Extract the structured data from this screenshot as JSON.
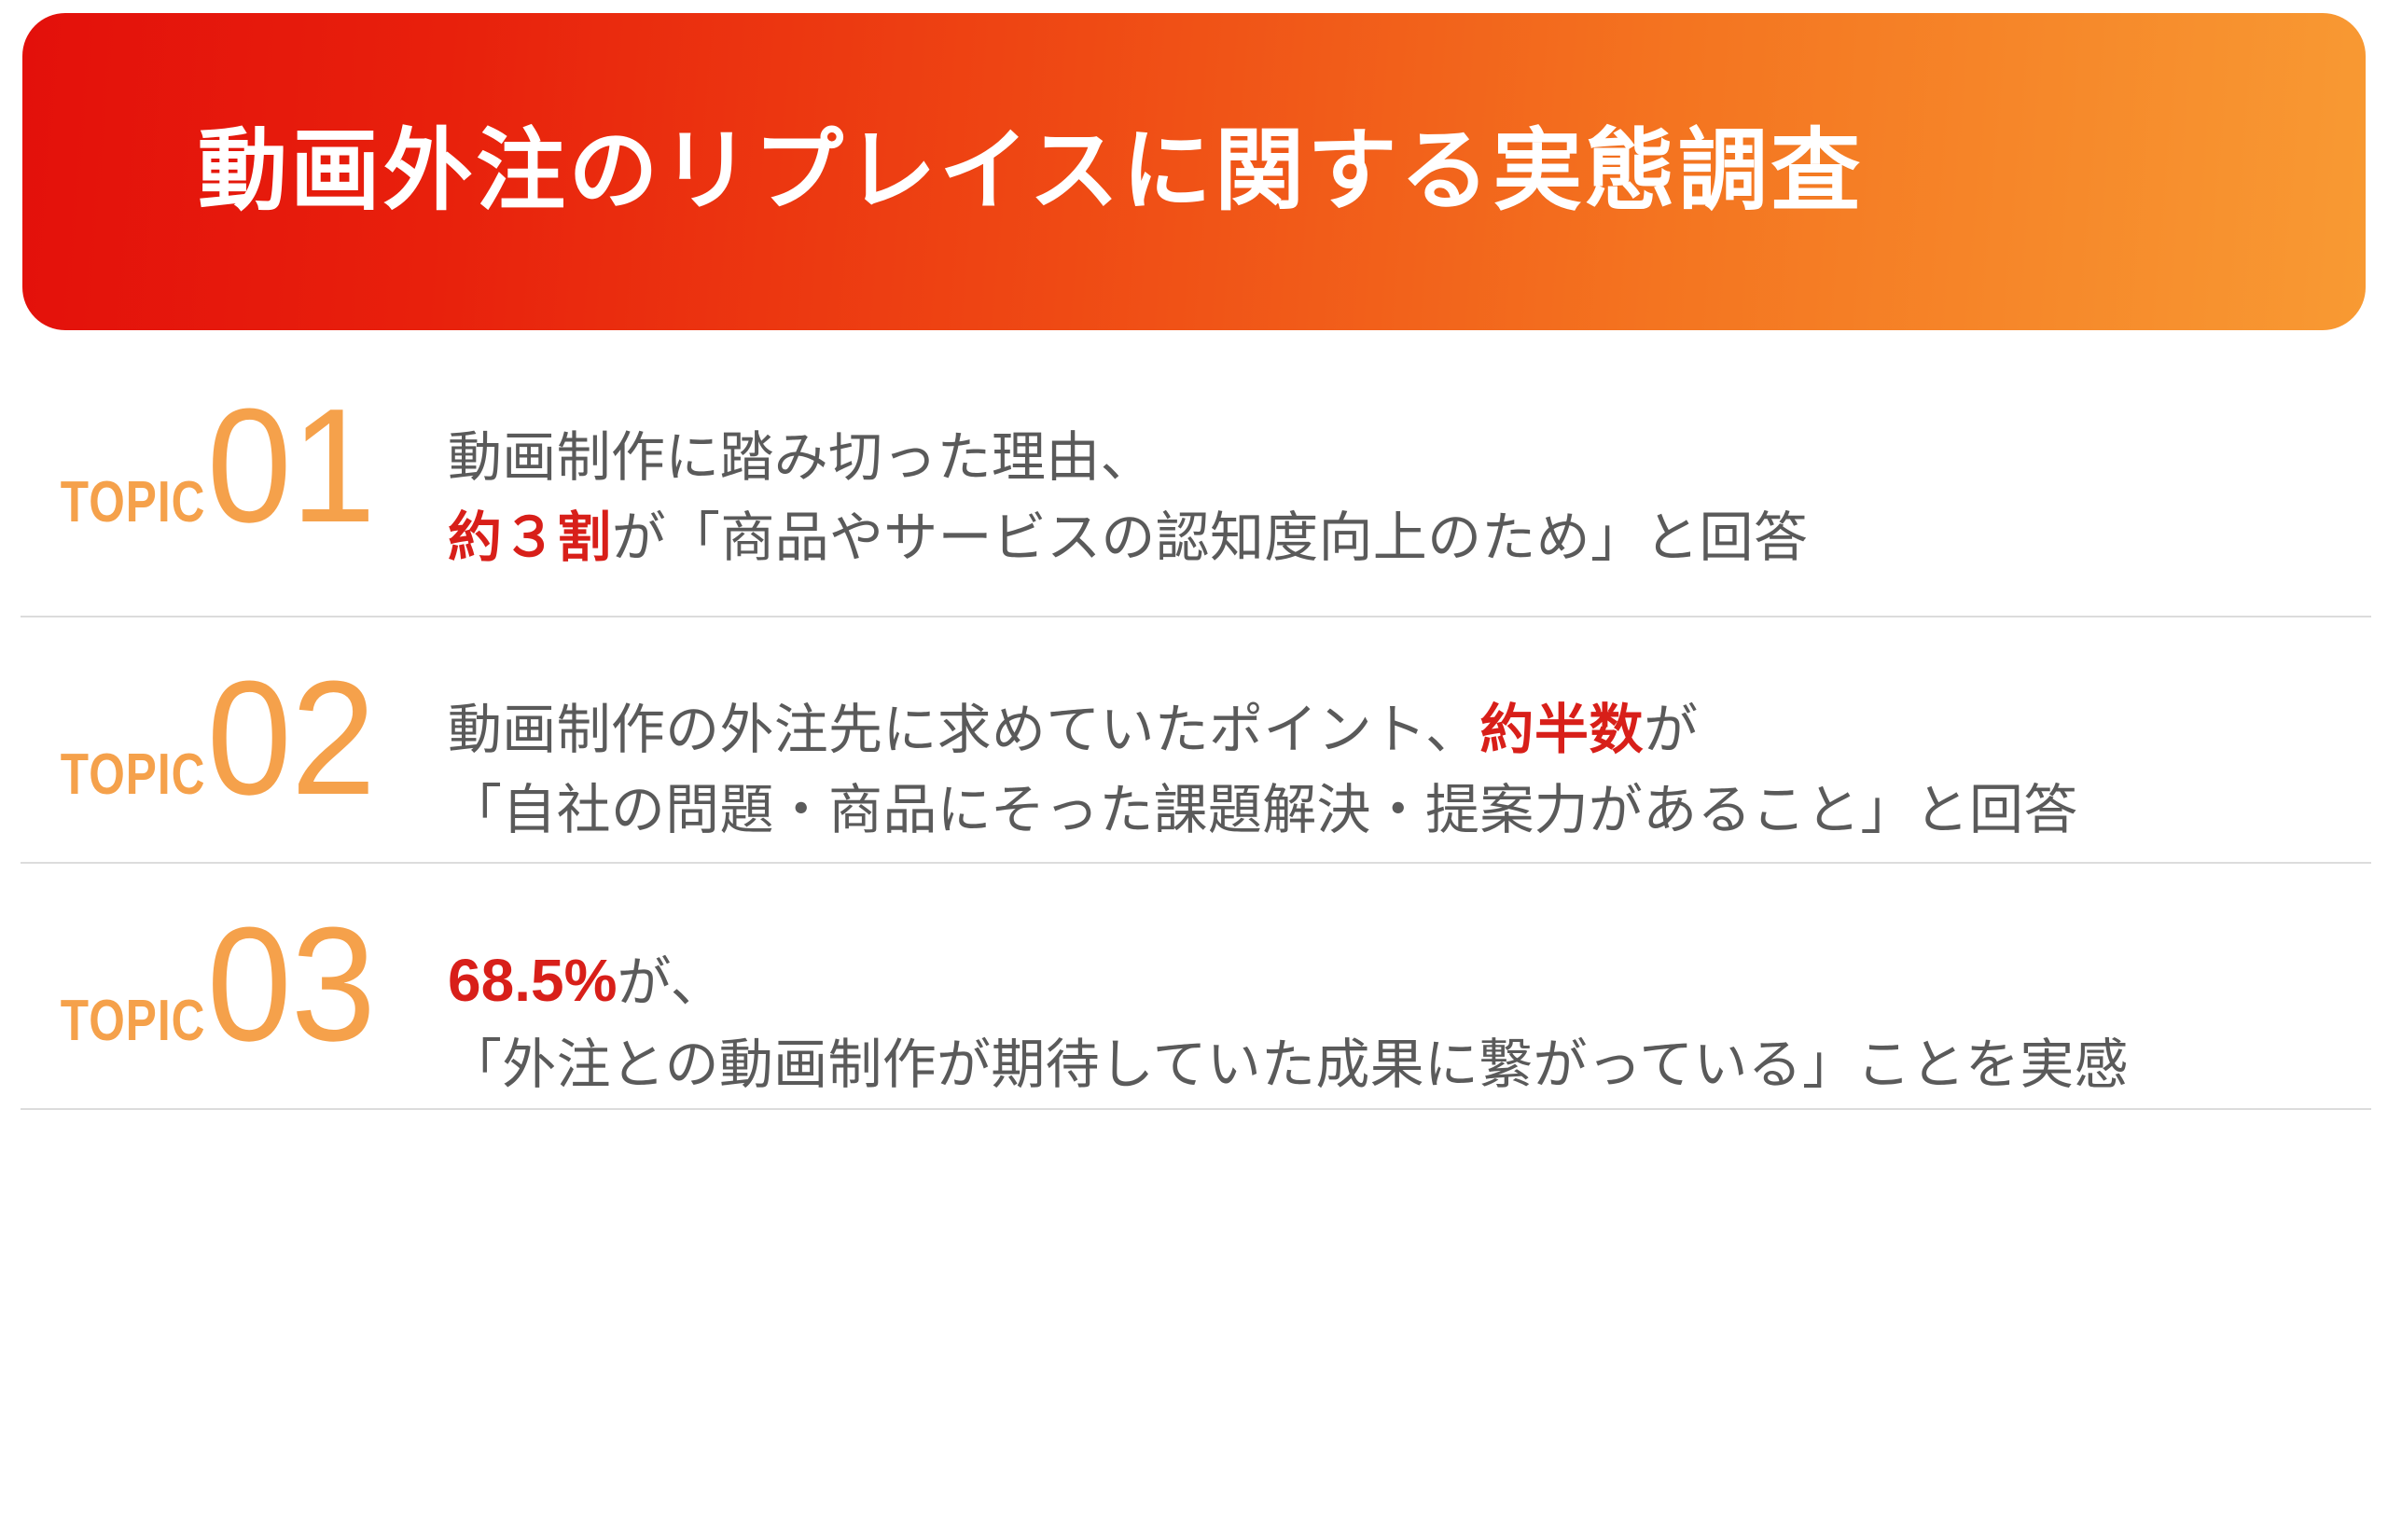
{
  "banner": {
    "title": "動画外注のリプレイスに関する実態調査",
    "gradient_start": "#e3100b",
    "gradient_end": "#f89a33",
    "text_color": "#ffffff"
  },
  "colors": {
    "topic_orange": "#f5a14b",
    "emphasis_red": "#d81f19",
    "body_gray": "#5a5a5a",
    "divider_gray": "#dcdcdc",
    "background": "#ffffff"
  },
  "topic_label": "TOPIC",
  "topics": [
    {
      "number": "01",
      "label": "TOPIC",
      "line1": "動画制作に踏み切った理由、",
      "line2_pre": "",
      "line2_em": "約３割",
      "line2_post": "が「商品やサービスの認知度向上のため」と回答"
    },
    {
      "number": "02",
      "label": "TOPIC",
      "line1_pre": "動画制作の外注先に求めていたポイント、",
      "line1_em": "約半数",
      "line1_post": "が",
      "line2": "「自社の問題・商品にそった課題解決・提案力があること」と回答"
    },
    {
      "number": "03",
      "label": "TOPIC",
      "line1_em": "68.5%",
      "line1_post": "が、",
      "line2": "「外注との動画制作が期待していた成果に繋がっている」ことを実感"
    }
  ]
}
